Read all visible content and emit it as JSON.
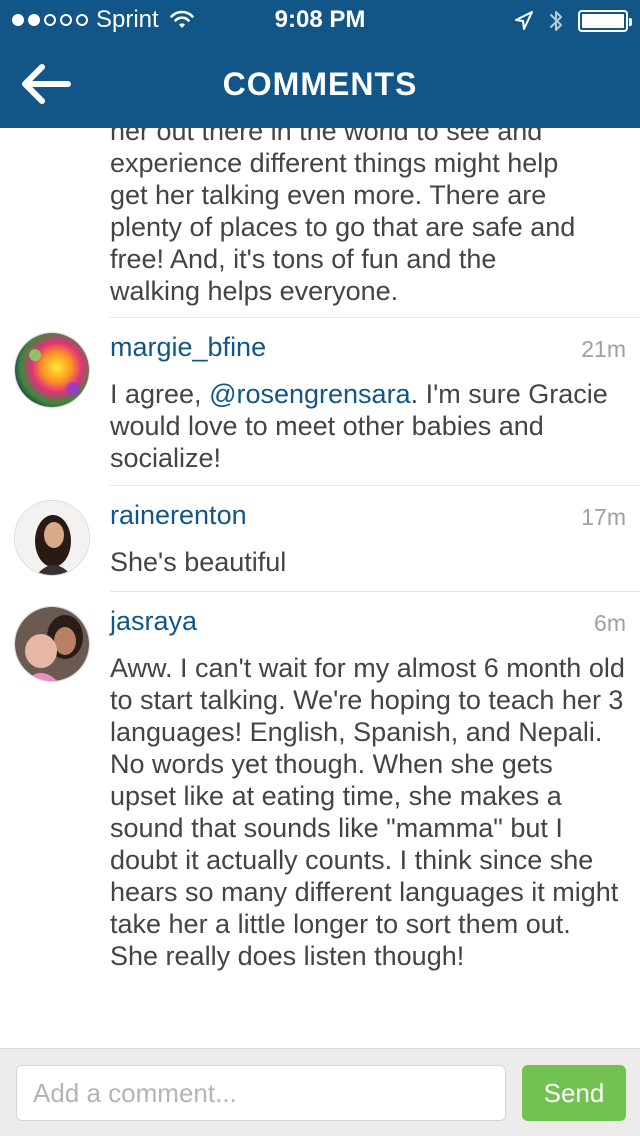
{
  "status_bar": {
    "carrier": "Sprint",
    "time": "9:08 PM",
    "signal_bars_filled": 2,
    "signal_bars_total": 5
  },
  "nav": {
    "title": "COMMENTS",
    "back_icon": "back-arrow-icon"
  },
  "first_comment_partial": {
    "text_lines": [
      "her out there in the world to see and",
      "experience different things might help",
      "get her talking even more. There are",
      "plenty of places to go that are safe and",
      "free!  And, it's tons of fun and the",
      "walking helps everyone."
    ]
  },
  "comments": [
    {
      "username": "margie_bfine",
      "time": "21m",
      "text_before": "I agree, ",
      "mention": "@rosengrensara",
      "text_after": ". I'm sure Gracie would love to meet other babies and socialize!"
    },
    {
      "username": "rainerenton",
      "time": "17m",
      "text": "She's beautiful"
    },
    {
      "username": "jasraya",
      "time": "6m",
      "text": "Aww. I can't wait for my almost 6 month old to start talking. We're hoping to teach her 3 languages! English, Spanish, and Nepali. No words yet though. When she gets upset like at eating time, she makes a sound that sounds like \"mamma\" but I doubt it actually counts. I think since she hears so many different languages it might take her a little longer to sort them out. She really does listen though!"
    }
  ],
  "input": {
    "placeholder": "Add a comment...",
    "value": "",
    "send_label": "Send"
  },
  "colors": {
    "brand_blue": "#125688",
    "send_green": "#6cc04a",
    "text_gray": "#444444",
    "time_gray": "#a0a0a0"
  }
}
